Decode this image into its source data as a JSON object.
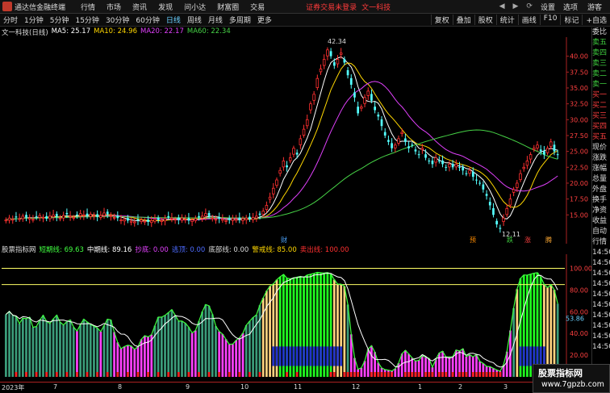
{
  "titlebar": {
    "app_title": "通达信金融终端",
    "menu": [
      "行情",
      "市场",
      "资讯",
      "发现",
      "问小达",
      "财富圈",
      "交易"
    ],
    "notice": "证券交易未登录",
    "brand": "文一科技",
    "right_menu": [
      "设置",
      "选项"
    ],
    "guest": "游客"
  },
  "toolbar": {
    "periods": [
      "分时",
      "1分钟",
      "5分钟",
      "15分钟",
      "30分钟",
      "60分钟",
      "日线",
      "周线",
      "月线",
      "多周期",
      "更多"
    ],
    "active_period": "日线",
    "tools": [
      "复权",
      "叠加",
      "股权",
      "统计",
      "画线",
      "F10",
      "标记",
      "+自选"
    ]
  },
  "quote": {
    "name": "文一科技(日线)",
    "ma5": "MA5: 25.17",
    "ma10": "MA10: 24.96",
    "ma20": "MA20: 22.17",
    "ma60": "MA60: 22.34"
  },
  "indicator": {
    "name": "股票指标网",
    "short_line": "短期线: 69.63",
    "mid_line": "中期线: 89.16",
    "buy_bottom": "抄底: 0.00",
    "escape_top": "逃顶: 0.00",
    "bottom_line": "底部线: 0.00",
    "warn_line": "警戒线: 85.00",
    "sell_line": "卖出线: 100.00"
  },
  "price_axis": [
    "40.00",
    "37.50",
    "35.00",
    "32.50",
    "30.00",
    "27.50",
    "25.00",
    "22.50",
    "20.00",
    "17.50",
    "15.00"
  ],
  "ind_axis": [
    "100.00",
    "80.00",
    "60.00",
    "40.00",
    "20.00"
  ],
  "ind_marker": "53.86",
  "annotations": {
    "high": "42.34",
    "low": "12.11",
    "events": [
      "财",
      "预",
      "跌",
      "涨",
      "腾"
    ]
  },
  "dates": [
    "2023年",
    "7",
    "8",
    "9",
    "10",
    "11",
    "12",
    "1",
    "2",
    "3"
  ],
  "right_panel": [
    "委比",
    "卖五",
    "卖四",
    "卖三",
    "卖二",
    "卖一",
    "买一",
    "买二",
    "买三",
    "买四",
    "买五",
    "现价",
    "涨跌",
    "涨幅",
    "总量",
    "外盘",
    "换手",
    "净资",
    "收益",
    "自动",
    "行情",
    "14:50",
    "14:50",
    "14:50",
    "14:50",
    "14:50",
    "14:50",
    "14:50",
    "14:50",
    "14:50",
    "14:50"
  ],
  "watermark": {
    "line1": "股票指标网",
    "line2": "www.7gpzb.com"
  },
  "colors": {
    "up": "#ff3030",
    "down": "#54ffff",
    "ma5": "#ffffff",
    "ma10": "#ffd700",
    "ma20": "#e040fb",
    "ma60": "#46d246"
  },
  "chart_data": {
    "type": "candlestick",
    "ylim": [
      13,
      42.5
    ],
    "ticks": [
      15,
      17.5,
      20,
      22.5,
      25,
      27.5,
      30,
      32.5,
      35,
      37.5,
      40
    ],
    "close": [
      14.2,
      14.5,
      14.3,
      14.6,
      14.4,
      14.8,
      14.6,
      14.5,
      14.3,
      14.7,
      14.9,
      14.6,
      14.4,
      14.8,
      15.0,
      14.7,
      14.5,
      14.9,
      15.1,
      14.8,
      14.6,
      14.9,
      15.2,
      15.0,
      14.8,
      15.1,
      14.9,
      14.7,
      14.9,
      15.3,
      15.1,
      14.9,
      14.6,
      14.5,
      14.2,
      14.3,
      14.1,
      14.0,
      13.9,
      14.1,
      14.2,
      14.0,
      13.9,
      14.1,
      14.3,
      14.2,
      14.1,
      14.4,
      14.6,
      14.5,
      14.3,
      14.2,
      14.5,
      14.3,
      14.1,
      14.2,
      14.4,
      14.6,
      14.8,
      15.2,
      14.8,
      14.5,
      14.3,
      14.4,
      14.3,
      14.1,
      14.2,
      14.4,
      14.3,
      14.2,
      14.4,
      14.5,
      14.3,
      14.6,
      14.8,
      15.0,
      15.6,
      16.5,
      17.8,
      19.2,
      20.5,
      22.0,
      23.5,
      22.5,
      24.0,
      25.5,
      24.5,
      27.0,
      28.5,
      30.0,
      32.5,
      34.0,
      36.5,
      38.0,
      39.5,
      41.0,
      40.0,
      38.5,
      39.5,
      40.5,
      39.0,
      37.0,
      35.5,
      33.5,
      31.0,
      32.0,
      33.5,
      34.5,
      33.0,
      31.5,
      30.5,
      29.0,
      27.5,
      26.5,
      25.5,
      26.0,
      27.0,
      28.0,
      26.5,
      25.5,
      26.0,
      25.0,
      24.5,
      25.5,
      24.0,
      23.5,
      23.0,
      24.0,
      23.5,
      23.0,
      22.5,
      23.0,
      22.5,
      23.0,
      22.5,
      22.0,
      21.5,
      22.0,
      21.0,
      20.5,
      20.0,
      19.0,
      18.0,
      16.5,
      15.0,
      13.5,
      12.8,
      14.5,
      16.0,
      17.5,
      19.0,
      20.0,
      21.5,
      22.5,
      23.5,
      24.5,
      25.5,
      26.0,
      25.0,
      24.5,
      25.5,
      26.5,
      25.0,
      24.5
    ]
  }
}
